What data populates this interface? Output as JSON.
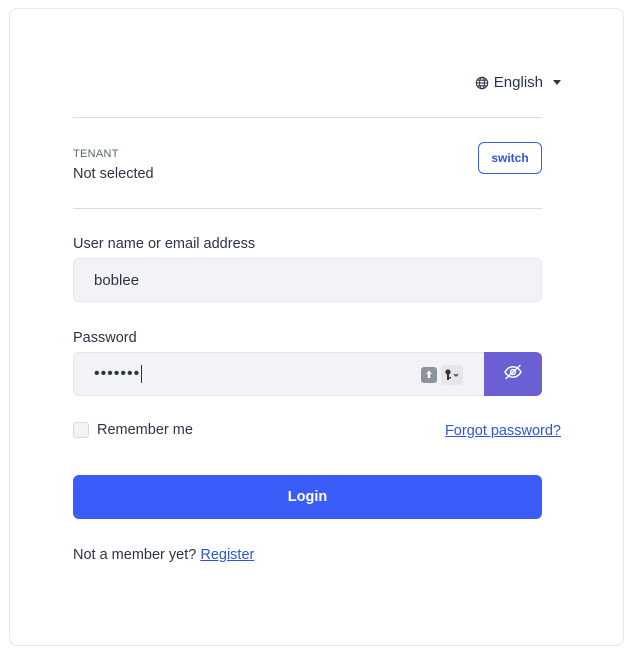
{
  "language": {
    "selected": "English"
  },
  "tenant": {
    "caption": "TENANT",
    "value": "Not selected",
    "switch_label": "switch"
  },
  "form": {
    "username_label": "User name or email address",
    "username_value": "boblee",
    "password_label": "Password",
    "password_masked": "•••••••",
    "remember_label": "Remember me",
    "forgot_label": "Forgot password?",
    "login_label": "Login"
  },
  "register": {
    "prompt": "Not a member yet?",
    "link": "Register"
  },
  "colors": {
    "primary": "#3a5cf9",
    "eye_button": "#6a5fd3",
    "link": "#2f55d4"
  }
}
